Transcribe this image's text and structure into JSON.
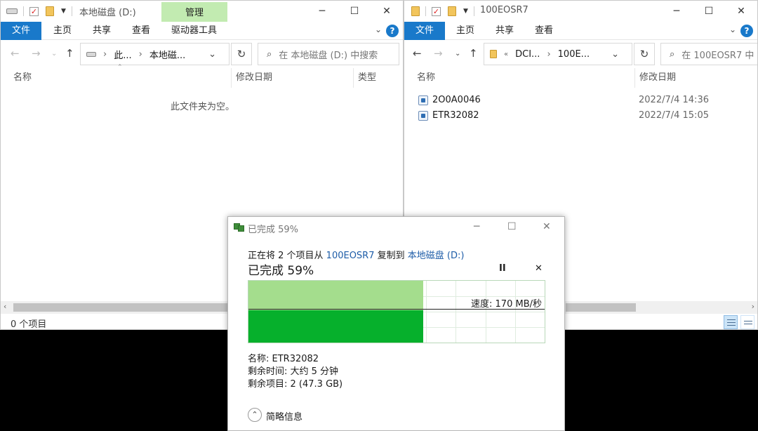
{
  "left": {
    "title": "本地磁盘 (D:)",
    "context_tab": "管理",
    "ribbon_tabs": [
      "文件",
      "主页",
      "共享",
      "查看",
      "驱动器工具"
    ],
    "address": [
      "此...",
      "本地磁..."
    ],
    "search_placeholder": "在 本地磁盘 (D:) 中搜索",
    "columns": [
      "名称",
      "修改日期",
      "类型"
    ],
    "empty_message": "此文件夹为空。",
    "status": "0 个项目"
  },
  "right": {
    "title": "100EOSR7",
    "ribbon_tabs": [
      "文件",
      "主页",
      "共享",
      "查看"
    ],
    "address": [
      "DCI...",
      "100E..."
    ],
    "search_placeholder": "在 100EOSR7 中",
    "columns": [
      "名称",
      "修改日期"
    ],
    "files": [
      {
        "name": "2O0A0046",
        "date": "2022/7/4 14:36"
      },
      {
        "name": "ETR32082",
        "date": "2022/7/4 15:05"
      }
    ]
  },
  "dialog": {
    "title": "已完成 59%",
    "line_prefix": "正在将 2 个项目从 ",
    "source": "100EOSR7",
    "line_mid": " 复制到 ",
    "destination": "本地磁盘 (D:)",
    "progress_text": "已完成 59%",
    "progress_percent": 59,
    "pause_symbol": "II",
    "cancel_symbol": "✕",
    "speed": "速度: 170 MB/秒",
    "name_line": "名称: ETR32082",
    "time_line": "剩余时间: 大约 5 分钟",
    "items_line": "剩余项目: 2 (47.3 GB)",
    "footer": "简略信息"
  },
  "colors": {
    "file_tab": "#1979ca",
    "context_tab": "#c2ebb1",
    "progress_light": "#a4dd8d",
    "progress_dark": "#06b02c"
  }
}
